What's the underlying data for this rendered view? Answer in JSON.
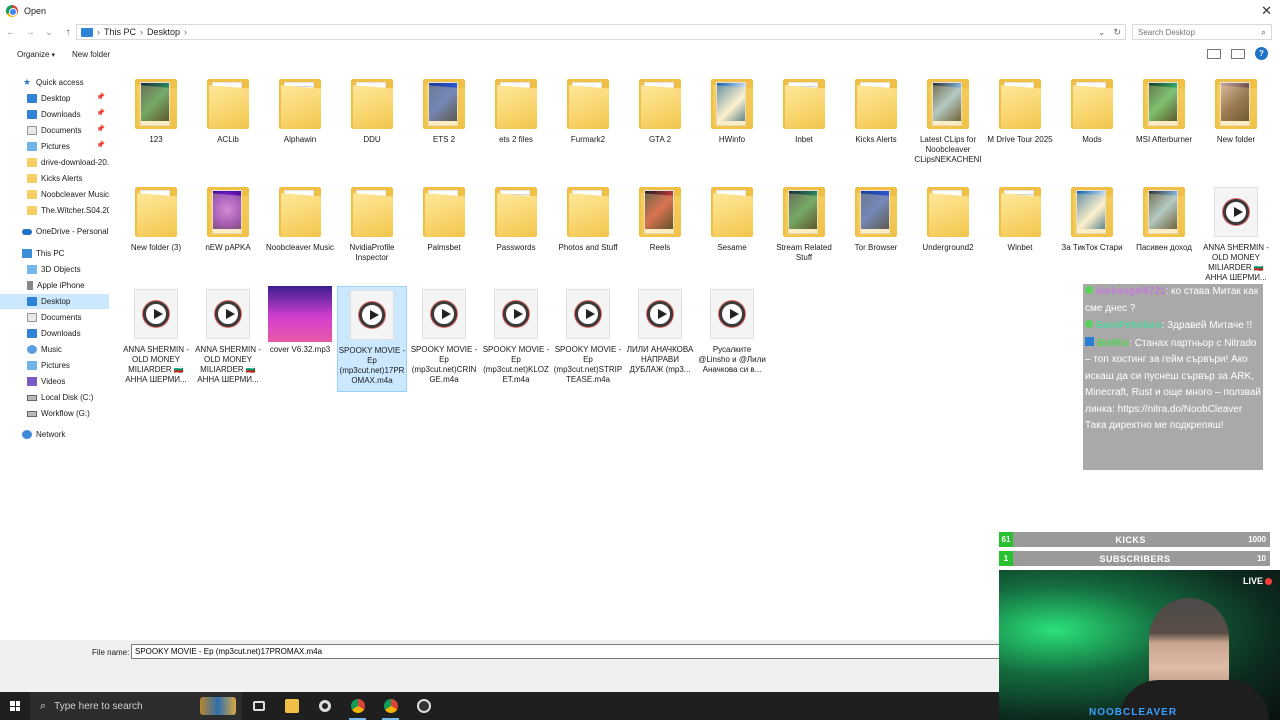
{
  "window": {
    "title": "Open"
  },
  "address": {
    "crumbs": [
      "This PC",
      "Desktop"
    ],
    "search_placeholder": "Search Desktop"
  },
  "toolbar": {
    "organize": "Organize",
    "new_folder": "New folder"
  },
  "sidebar": {
    "quick_access": "Quick access",
    "items": [
      {
        "label": "Desktop",
        "icon": "desktop-icon",
        "pinned": true,
        "selected": false
      },
      {
        "label": "Downloads",
        "icon": "downloads-icon",
        "pinned": true
      },
      {
        "label": "Documents",
        "icon": "documents-icon",
        "pinned": true
      },
      {
        "label": "Pictures",
        "icon": "pictures-icon",
        "pinned": true
      },
      {
        "label": "drive-download-20...",
        "icon": "folder-icon"
      },
      {
        "label": "Kicks Alerts",
        "icon": "folder-icon"
      },
      {
        "label": "Noobcleaver Music",
        "icon": "folder-icon"
      },
      {
        "label": "The.Witcher.S04.202...",
        "icon": "folder-icon"
      }
    ],
    "onedrive": "OneDrive - Personal",
    "this_pc": "This PC",
    "pc_items": [
      {
        "label": "3D Objects",
        "icon": "3d-objects-icon"
      },
      {
        "label": "Apple iPhone",
        "icon": "phone-icon"
      },
      {
        "label": "Desktop",
        "icon": "desktop-icon",
        "selected": true
      },
      {
        "label": "Documents",
        "icon": "documents-icon"
      },
      {
        "label": "Downloads",
        "icon": "downloads-icon"
      },
      {
        "label": "Music",
        "icon": "music-icon"
      },
      {
        "label": "Pictures",
        "icon": "pictures-icon"
      },
      {
        "label": "Videos",
        "icon": "videos-icon"
      },
      {
        "label": "Local Disk (C:)",
        "icon": "drive-icon"
      },
      {
        "label": "Workflow (G:)",
        "icon": "drive-icon"
      }
    ],
    "network": "Network"
  },
  "files": [
    {
      "name": "123",
      "kind": "folder-image"
    },
    {
      "name": "ACLib",
      "kind": "folder"
    },
    {
      "name": "Alphawin",
      "kind": "folder-doc"
    },
    {
      "name": "DDU",
      "kind": "folder"
    },
    {
      "name": "ETS 2",
      "kind": "folder-image"
    },
    {
      "name": "ets 2 files",
      "kind": "folder"
    },
    {
      "name": "Furmark2",
      "kind": "folder"
    },
    {
      "name": "GTA 2",
      "kind": "folder"
    },
    {
      "name": "HWinfo",
      "kind": "folder-image"
    },
    {
      "name": "Inbet",
      "kind": "folder-doc"
    },
    {
      "name": "Kicks Alerts",
      "kind": "folder"
    },
    {
      "name": "Latest CLips for Noobcleaver CLipsNEKACHENI",
      "kind": "folder-image"
    },
    {
      "name": "M Drive Tour 2025",
      "kind": "folder"
    },
    {
      "name": "Mods",
      "kind": "folder"
    },
    {
      "name": "MSI Afterburner",
      "kind": "folder-image"
    },
    {
      "name": "New folder",
      "kind": "folder-image"
    },
    {
      "name": "New folder (3)",
      "kind": "folder"
    },
    {
      "name": "nEW pAPKA",
      "kind": "folder-image"
    },
    {
      "name": "Noobcleaver Music",
      "kind": "folder"
    },
    {
      "name": "NvidiaProfile Inspector",
      "kind": "folder"
    },
    {
      "name": "Palmsbet",
      "kind": "folder"
    },
    {
      "name": "Passwords",
      "kind": "folder-doc"
    },
    {
      "name": "Photos and Stuff",
      "kind": "folder"
    },
    {
      "name": "Reels",
      "kind": "folder-image"
    },
    {
      "name": "Sesame",
      "kind": "folder"
    },
    {
      "name": "Stream Related Stuff",
      "kind": "folder-image"
    },
    {
      "name": "Tor Browser",
      "kind": "folder-image"
    },
    {
      "name": "Underground2",
      "kind": "folder"
    },
    {
      "name": "Winbet",
      "kind": "folder-doc"
    },
    {
      "name": "За ТикТок Стари",
      "kind": "folder-image"
    },
    {
      "name": "Пасивен доход",
      "kind": "folder-image"
    },
    {
      "name": "ANNA SHERMIN - OLD MONEY MILIARDER 🇧🇬 АННА ШЕРМИ...",
      "kind": "media"
    },
    {
      "name": "ANNA SHERMIN - OLD MONEY MILIARDER 🇧🇬 АННА ШЕРМИ...",
      "kind": "media"
    },
    {
      "name": "ANNA SHERMIN - OLD MONEY MILIARDER 🇧🇬 АННА ШЕРМИ...",
      "kind": "media"
    },
    {
      "name": "cover V6.32.mp3",
      "kind": "cover"
    },
    {
      "name": "SPOOKY MOVIE - Ep (mp3cut.net)17PROMAX.m4a",
      "kind": "media",
      "selected": true
    },
    {
      "name": "SPOOKY MOVIE - Ep (mp3cut.net)CRINGE.m4a",
      "kind": "media"
    },
    {
      "name": "SPOOKY MOVIE - Ep (mp3cut.net)KLOZET.m4a",
      "kind": "media"
    },
    {
      "name": "SPOOKY MOVIE - Ep (mp3cut.net)STRIPTEASE.m4a",
      "kind": "media"
    },
    {
      "name": "ЛИЛИ АНАЧКОВА НАПРАВИ ДУБЛАЖ (mp3...",
      "kind": "media"
    },
    {
      "name": "Русалките @Linsho и @Лили Аначкова си в...",
      "kind": "media"
    }
  ],
  "filename": {
    "label": "File name:",
    "value": "SPOOKY MOVIE - Ep (mp3cut.net)17PROMAX.m4a"
  },
  "taskbar": {
    "search_placeholder": "Type here to search"
  },
  "overlay": {
    "chat": [
      {
        "user": "darkangel9721",
        "text": ": ко става Митак как сме днес ?"
      },
      {
        "user": "BaroPeholaro",
        "text": ": Здравей Митаче !!"
      },
      {
        "user": "BotRix",
        "text": ": Станах партньор с Nitrado – топ хостинг за гейм сървъри! Ако искаш да си пуснеш сървър за ARK, Minecraft, Rust и още много – ползвай линка: https://nitra.do/NoobCleaver Така директно ме подкрепяш!"
      }
    ],
    "kicks": {
      "count": "61",
      "label": "KICKS",
      "target": "1000"
    },
    "subs": {
      "count": "1",
      "label": "SUBSCRIBERS",
      "target": "10"
    },
    "live": "LIVE",
    "cam_tag": "NOOBCLEAVER"
  },
  "colors": {
    "selection": "#cce8ff",
    "folder": "#f8d46c",
    "accent": "#2f83d6",
    "goal_green": "#27c12f"
  }
}
